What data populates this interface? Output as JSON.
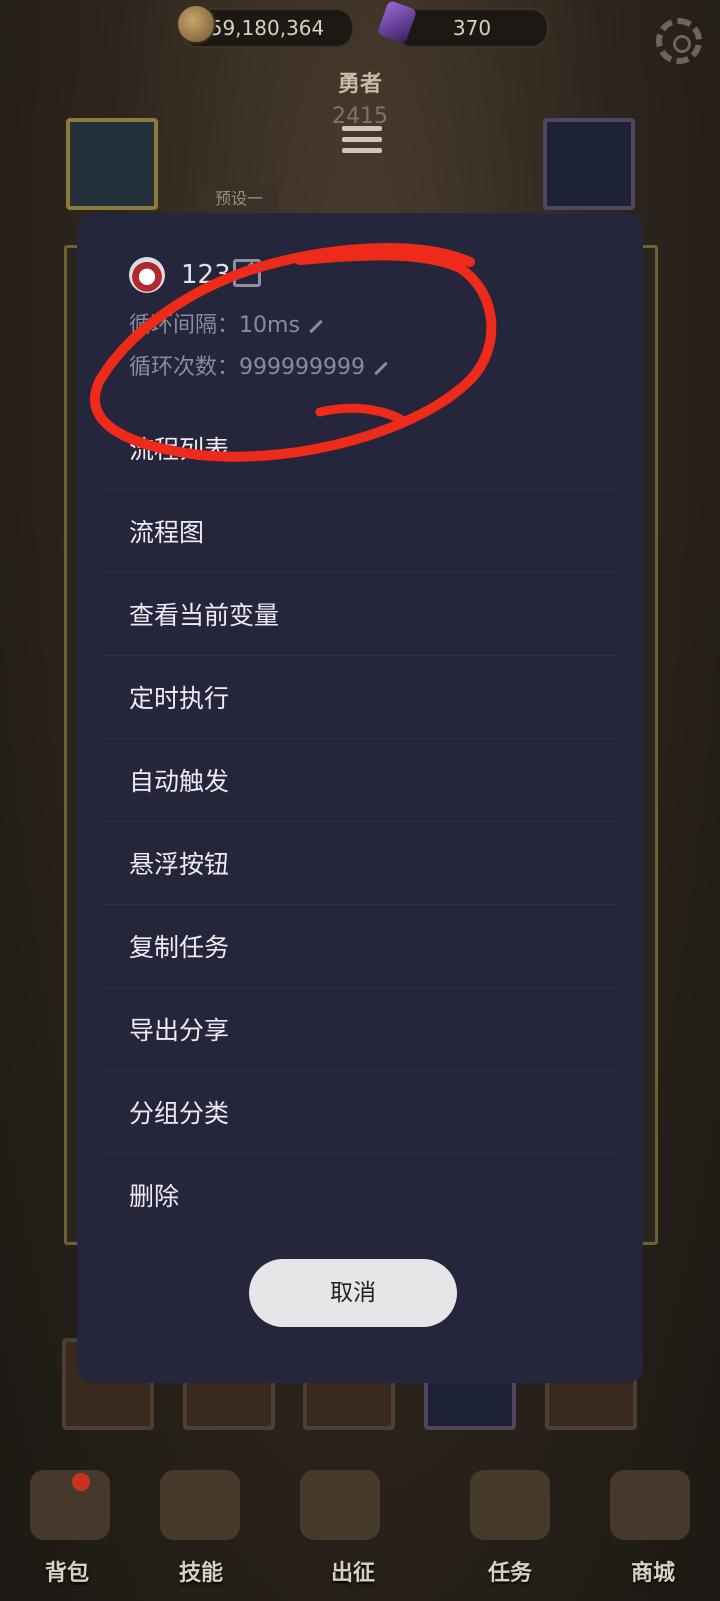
{
  "resources": {
    "gold": "59,180,364",
    "gems": "370"
  },
  "hero": {
    "title": "勇者",
    "power": "2415",
    "preset": "预设一"
  },
  "bottom_tabs": [
    {
      "label": "背包"
    },
    {
      "label": "技能"
    },
    {
      "label": "出征"
    },
    {
      "label": "任务"
    },
    {
      "label": "商城"
    }
  ],
  "dialog": {
    "task_name": "123",
    "loop_interval_label": "循环间隔：",
    "loop_interval_value": "10ms",
    "loop_count_label": "循环次数：",
    "loop_count_value": "999999999",
    "menu": [
      {
        "label": "流程列表"
      },
      {
        "label": "流程图"
      },
      {
        "label": "查看当前变量"
      },
      {
        "label": "定时执行"
      },
      {
        "label": "自动触发"
      },
      {
        "label": "悬浮按钮"
      },
      {
        "label": "复制任务"
      },
      {
        "label": "导出分享"
      },
      {
        "label": "分组分类"
      },
      {
        "label": "删除"
      }
    ],
    "cancel_label": "取消"
  },
  "colors": {
    "dialog_bg": "#25253b",
    "annotation": "#ee2a1b"
  }
}
